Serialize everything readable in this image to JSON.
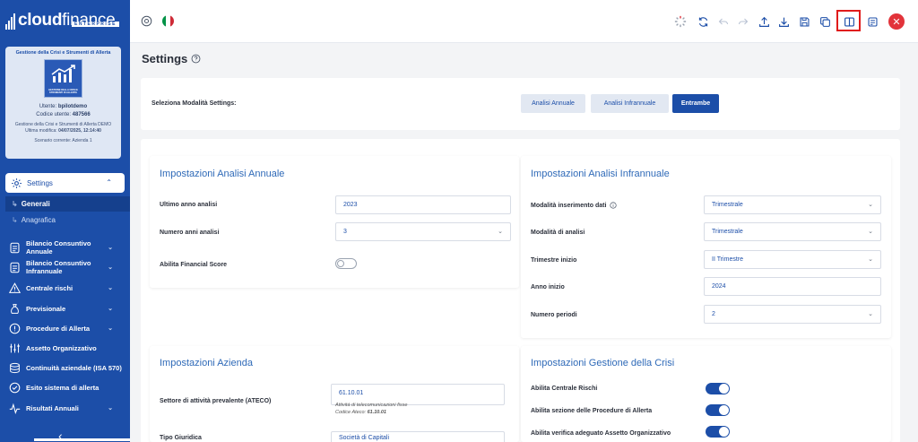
{
  "app": {
    "logo_bold": "cloud",
    "logo_light": "finance",
    "logo_sub": "ENTERPRISE"
  },
  "sidebar": {
    "card": {
      "title": "Gestione della Crisi e Strumenti di Allerta",
      "image_caption": "GESTIONE DELLA CRISI E STRUMENTI DI ALLERTA",
      "user_label": "Utente:",
      "user_value": "bpilotdemo",
      "code_label": "Codice utente:",
      "code_value": "487566",
      "company_line": "Gestione della Crisi e Strumenti di Allerta DEMO",
      "modified_label": "Ultima modifica:",
      "modified_value": "04/07/2025, 12:14:40",
      "scenario": "Scenario corrente: Azienda 1"
    },
    "settings_label": "Settings",
    "sub_items": [
      {
        "label": "Generali",
        "active": true
      },
      {
        "label": "Anagrafica",
        "active": false
      }
    ],
    "nav": [
      {
        "label_1": "Bilancio Consuntivo",
        "label_2": "Annuale",
        "icon": "document-icon"
      },
      {
        "label_1": "Bilancio Consuntivo",
        "label_2": "Infrannuale",
        "icon": "document-icon"
      },
      {
        "label_1": "Centrale rischi",
        "label_2": "",
        "icon": "warning-icon"
      },
      {
        "label_1": "Previsionale",
        "label_2": "",
        "icon": "moneybag-icon"
      },
      {
        "label_1": "Procedure di Allerta",
        "label_2": "",
        "icon": "alert-circle-icon"
      },
      {
        "label_1": "Assetto Organizzativo",
        "label_2": "",
        "icon": "org-chart-icon"
      },
      {
        "label_1": "Continuità aziendale (ISA 570)",
        "label_2": "",
        "icon": "database-icon"
      },
      {
        "label_1": "Esito sistema di allerta",
        "label_2": "",
        "icon": "check-circle-icon"
      },
      {
        "label_1": "Risultati Annuali",
        "label_2": "",
        "icon": "pulse-icon"
      }
    ],
    "collapse_glyph": "‹"
  },
  "toolbar": {
    "flag_colors": [
      "#009246",
      "#ffffff",
      "#ce2b37"
    ],
    "close_glyph": "✕"
  },
  "page": {
    "title": "Settings"
  },
  "mode": {
    "label": "Seleziona Modalità Settings:",
    "buttons": [
      "Analisi Annuale",
      "Analisi Infrannuale",
      "Entrambe"
    ],
    "selected": "Entrambe"
  },
  "annual": {
    "title": "Impostazioni Analisi Annuale",
    "rows": [
      {
        "label": "Ultimo anno analisi",
        "value": "2023"
      },
      {
        "label": "Numero anni analisi",
        "value": "3"
      },
      {
        "label": "Abilita Financial Score",
        "value": false
      }
    ]
  },
  "infra": {
    "title": "Impostazioni Analisi Infrannuale",
    "rows": [
      {
        "label": "Modalità inserimento dati",
        "value": "Trimestrale"
      },
      {
        "label": "Modalità di analisi",
        "value": "Trimestrale"
      },
      {
        "label": "Trimestre inizio",
        "value": "II Trimestre"
      },
      {
        "label": "Anno inizio",
        "value": "2024"
      },
      {
        "label": "Numero periodi",
        "value": "2"
      }
    ]
  },
  "company": {
    "title": "Impostazioni Azienda",
    "ateco_label": "Settore di attività prevalente (ATECO)",
    "ateco_value": "61.10.01",
    "ateco_desc": "Attività di telecomunicazioni fisse",
    "ateco_code_label": "Codice Ateco:",
    "ateco_code_value": "61.10.01",
    "next_label": "Tipo Giuridica",
    "next_value": "Società di Capitali"
  },
  "crisis": {
    "title": "Impostazioni Gestione della Crisi",
    "rows": [
      {
        "label": "Abilita Centrale Rischi",
        "value": true
      },
      {
        "label": "Abilita sezione delle Procedure di Allerta",
        "value": true
      },
      {
        "label": "Abilita verifica adeguato Assetto Organizzativo",
        "value": true
      }
    ]
  }
}
